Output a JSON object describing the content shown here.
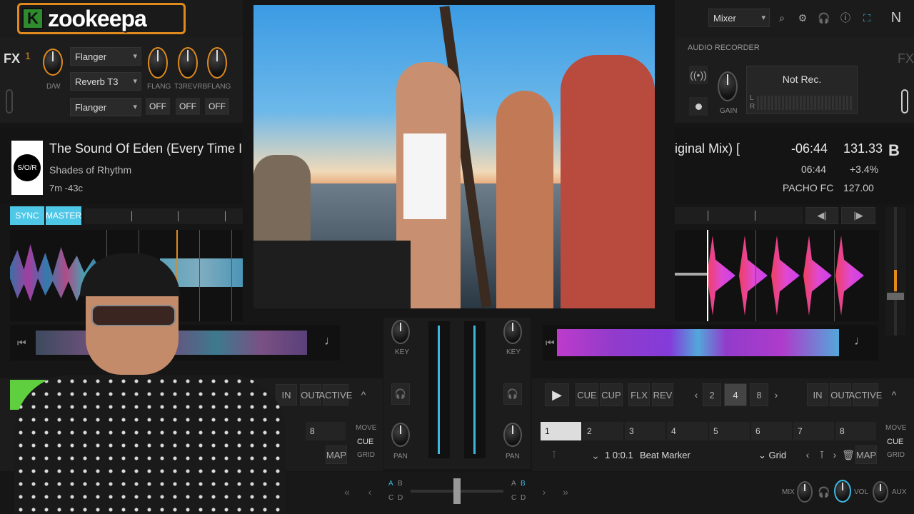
{
  "logo": {
    "badge": "K",
    "text": "zookeepa"
  },
  "fx": {
    "label": "FX",
    "unit": "1",
    "dw_label": "D/W",
    "effects": [
      "Flanger",
      "Reverb T3",
      "Flanger"
    ],
    "knob_labels": [
      "FLANG",
      "T3REVRB",
      "FLANG"
    ],
    "toggles": [
      "OFF",
      "OFF",
      "OFF"
    ]
  },
  "header": {
    "mode": "Mixer"
  },
  "recorder": {
    "title": "AUDIO RECORDER",
    "status": "Not Rec.",
    "gain_label": "GAIN",
    "l": "L",
    "r": "R",
    "fx_label": "FX"
  },
  "deckA": {
    "title": "The Sound Of Eden (Every Time I See Her)",
    "artist": "Shades of Rhythm",
    "duration": "7m -43c",
    "art": "S/O/R",
    "sync": "SYNC",
    "master": "MASTER",
    "loop_in": "IN",
    "loop_out": "OUT",
    "loop_active": "ACTIVE",
    "cue_num": "8",
    "move": "MOVE",
    "cue": "CUE",
    "grid": "GRID",
    "map": "MAP"
  },
  "deckB": {
    "letter": "B",
    "title_partial": "iginal Mix) [",
    "remaining": "-06:44",
    "bpm": "131.33",
    "elapsed": "06:44",
    "pitch": "+3.4%",
    "artist": "PACHO FC",
    "orig_bpm": "127.00",
    "cue_label": "CUE",
    "cup_label": "CUP",
    "flx_label": "FLX",
    "rev_label": "REV",
    "loop_sizes": [
      "2",
      "4",
      "8"
    ],
    "loop_in": "IN",
    "loop_out": "OUT",
    "loop_active": "ACTIVE",
    "cue_points": [
      "1",
      "2",
      "3",
      "4",
      "5",
      "6",
      "7",
      "8"
    ],
    "beat_pos": "1 0:0.1",
    "beat_marker": "Beat Marker",
    "grid_dropdown": "Grid",
    "map": "MAP",
    "move": "MOVE",
    "cue": "CUE",
    "grid": "GRID"
  },
  "mixer": {
    "key": "KEY",
    "pan": "PAN",
    "xfade_left_a": "A",
    "xfade_left_b": "B",
    "xfade_left_c": "C",
    "xfade_left_d": "D",
    "xfade_right_a": "A",
    "xfade_right_b": "B",
    "xfade_right_c": "C",
    "xfade_right_d": "D"
  },
  "master": {
    "mix": "MIX",
    "vol": "VOL",
    "aux": "AUX"
  },
  "colors": {
    "accent": "#3bb7e0",
    "orange": "#e08a1e",
    "sync": "#4fc8e8"
  }
}
